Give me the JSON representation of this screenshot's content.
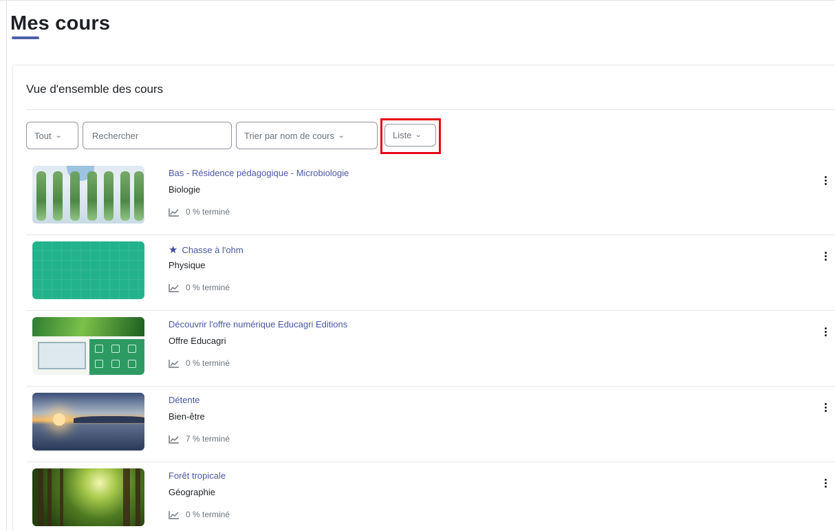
{
  "page": {
    "title": "Mes cours"
  },
  "overview": {
    "header": "Vue d'ensemble des cours",
    "controls": {
      "filter_label": "Tout",
      "search_placeholder": "Rechercher",
      "sort_label": "Trier par nom de cours",
      "view_label": "Liste"
    }
  },
  "courses": [
    {
      "name": "Bas - Résidence pédagogique - Microbiologie",
      "category": "Biologie",
      "progress": "0 % terminé",
      "starred": false
    },
    {
      "name": "Chasse à l'ohm",
      "category": "Physique",
      "progress": "0 % terminé",
      "starred": true
    },
    {
      "name": "Découvrir l'offre numérique Educagri Editions",
      "category": "Offre Educagri",
      "progress": "0 % terminé",
      "starred": false
    },
    {
      "name": "Détente",
      "category": "Bien-être",
      "progress": "7 % terminé",
      "starred": false
    },
    {
      "name": "Forêt tropicale",
      "category": "Géographie",
      "progress": "0 % terminé",
      "starred": false
    }
  ],
  "colors": {
    "accent": "#4a5fa8",
    "link": "#4a56a6",
    "highlight": "#e50914"
  },
  "icons": {
    "progress": "chart-line-icon",
    "menu": "three-dots-vertical-icon",
    "star": "star-icon",
    "dropdown": "chevron-down-icon"
  }
}
